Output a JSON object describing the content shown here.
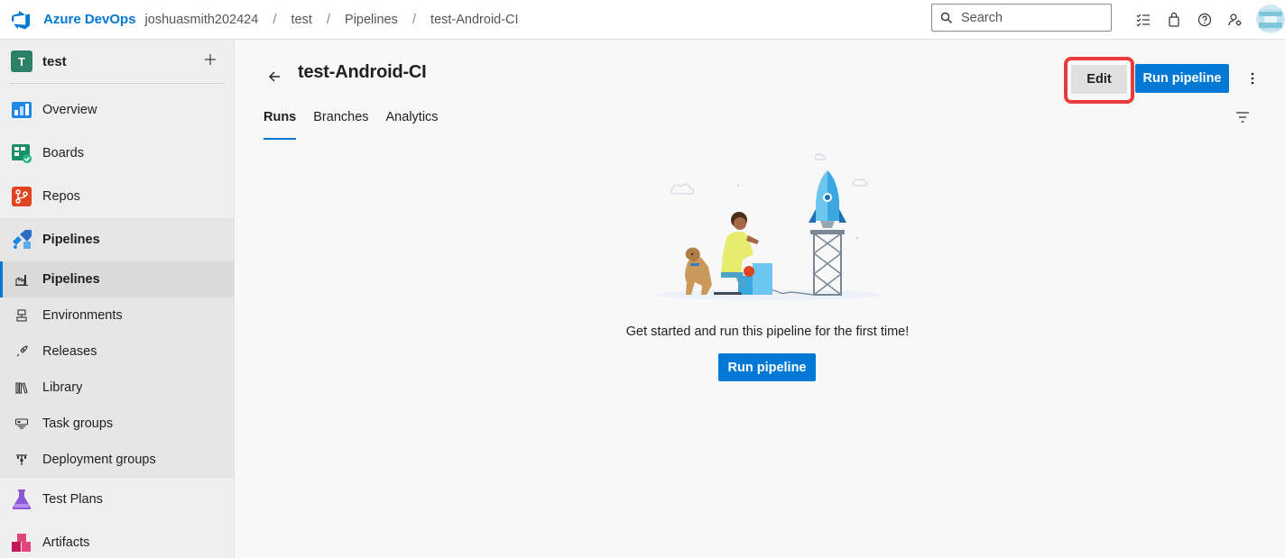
{
  "header": {
    "brand": "Azure DevOps",
    "breadcrumbs": [
      "joshuasmith202424",
      "test",
      "Pipelines",
      "test-Android-CI"
    ],
    "separator": "/",
    "search_placeholder": "Search",
    "icons": [
      "task-list-icon",
      "shopping-bag-icon",
      "help-icon",
      "user-settings-icon"
    ]
  },
  "sidebar": {
    "project_initial": "T",
    "project_name": "test",
    "project_color": "#2b8065",
    "add_icon": "plus-icon",
    "items": [
      {
        "label": "Overview",
        "icon": "overview-icon"
      },
      {
        "label": "Boards",
        "icon": "boards-icon"
      },
      {
        "label": "Repos",
        "icon": "repos-icon"
      },
      {
        "label": "Pipelines",
        "icon": "pipelines-icon"
      }
    ],
    "pipelines_sub": [
      {
        "label": "Pipelines",
        "icon": "pipelines-sub-icon",
        "active": true
      },
      {
        "label": "Environments",
        "icon": "environments-icon"
      },
      {
        "label": "Releases",
        "icon": "releases-icon"
      },
      {
        "label": "Library",
        "icon": "library-icon"
      },
      {
        "label": "Task groups",
        "icon": "task-groups-icon"
      },
      {
        "label": "Deployment groups",
        "icon": "deployment-groups-icon"
      }
    ],
    "bottom_items": [
      {
        "label": "Test Plans",
        "icon": "test-plans-icon"
      },
      {
        "label": "Artifacts",
        "icon": "artifacts-icon"
      }
    ]
  },
  "main": {
    "title": "test-Android-CI",
    "edit_label": "Edit",
    "run_label": "Run pipeline",
    "tabs": [
      "Runs",
      "Branches",
      "Analytics"
    ],
    "active_tab": "Runs",
    "empty_message": "Get started and run this pipeline for the first time!",
    "empty_button": "Run pipeline"
  },
  "colors": {
    "accent": "#0078d4",
    "highlight": "#e83b3b"
  }
}
